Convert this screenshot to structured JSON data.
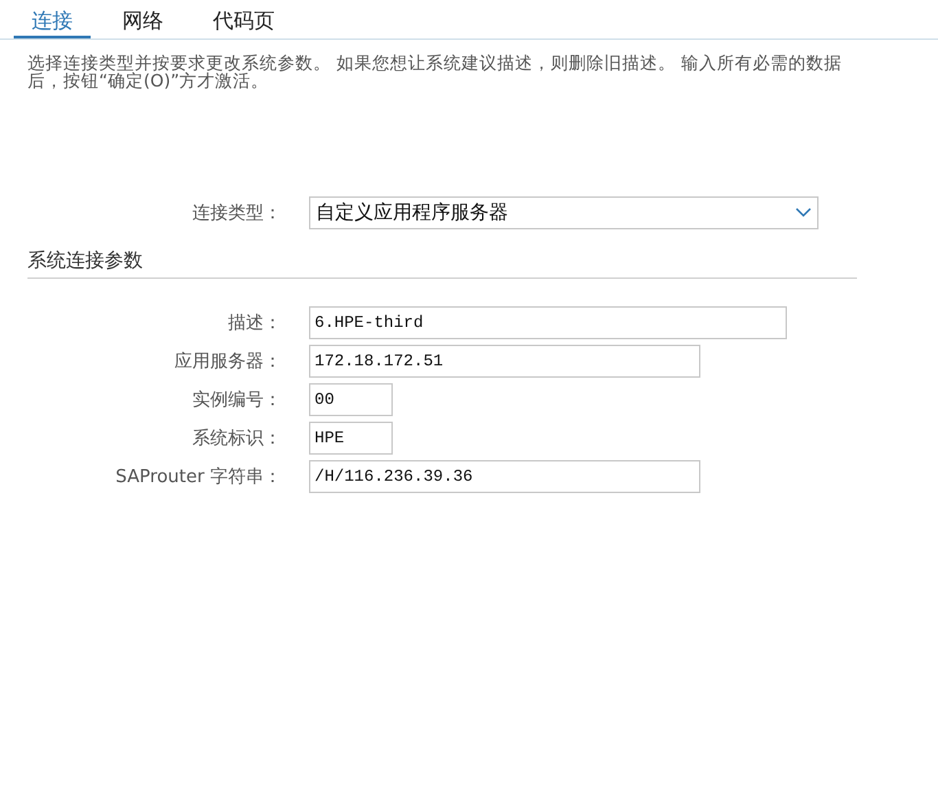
{
  "tabs": [
    {
      "label": "连接",
      "selected": true
    },
    {
      "label": "网络",
      "selected": false
    },
    {
      "label": "代码页",
      "selected": false
    }
  ],
  "intro": "选择连接类型并按要求更改系统参数。 如果您想让系统建议描述，则删除旧描述。 输入所有必需的数据后，按钮“确定(O)”方才激活。",
  "connection_type": {
    "label": "连接类型：",
    "value": "自定义应用程序服务器"
  },
  "section": {
    "title": "系统连接参数",
    "fields": [
      {
        "label": "描述：",
        "value": "6.HPE-third"
      },
      {
        "label": "应用服务器：",
        "value": "172.18.172.51"
      },
      {
        "label": "实例编号：",
        "value": "00"
      },
      {
        "label": "系统标识：",
        "value": "HPE"
      },
      {
        "label": "SAProuter 字符串：",
        "value": "/H/116.236.39.36"
      }
    ]
  }
}
